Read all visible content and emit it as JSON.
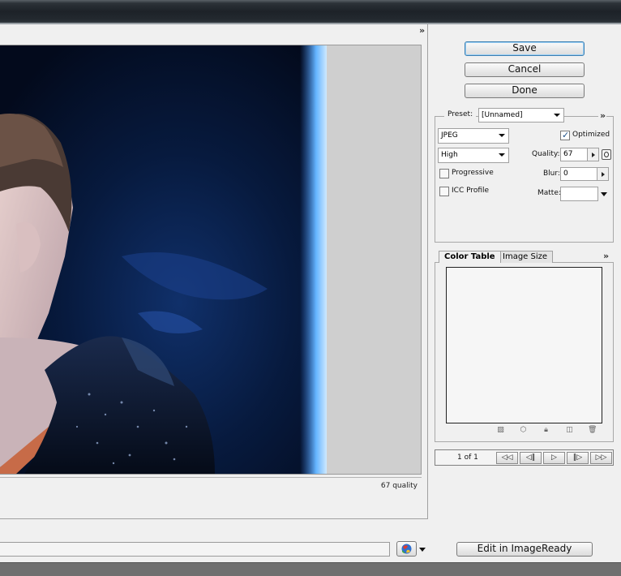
{
  "preview": {
    "quality_readout": "67 quality",
    "panel_menu_glyph": "»"
  },
  "actions": {
    "save_label": "Save",
    "cancel_label": "Cancel",
    "done_label": "Done"
  },
  "settings": {
    "preset_label": "Preset:",
    "preset_value": "[Unnamed]",
    "panel_menu_glyph": "»",
    "format_value": "JPEG",
    "quality_preset_value": "High",
    "optimized_label": "Optimized",
    "optimized_checked": true,
    "quality_label": "Quality:",
    "quality_value": "67",
    "progressive_label": "Progressive",
    "progressive_checked": false,
    "blur_label": "Blur:",
    "blur_value": "0",
    "icc_label": "ICC Profile",
    "icc_checked": false,
    "matte_label": "Matte:",
    "matte_value": ""
  },
  "color_panel": {
    "tabs": [
      "Color Table",
      "Image Size"
    ],
    "active_tab": "Color Table",
    "panel_menu_glyph": "»"
  },
  "animation": {
    "frame_counter": "1 of 1",
    "buttons": [
      "◁◁",
      "◁‖",
      "▷",
      "‖▷",
      "▷▷"
    ]
  },
  "footer": {
    "edit_button_label": "Edit in ImageReady"
  },
  "colors": {
    "title_bar": "#23292f",
    "focus_border": "#3c7fb1",
    "checkmark": "#1c4f86"
  }
}
